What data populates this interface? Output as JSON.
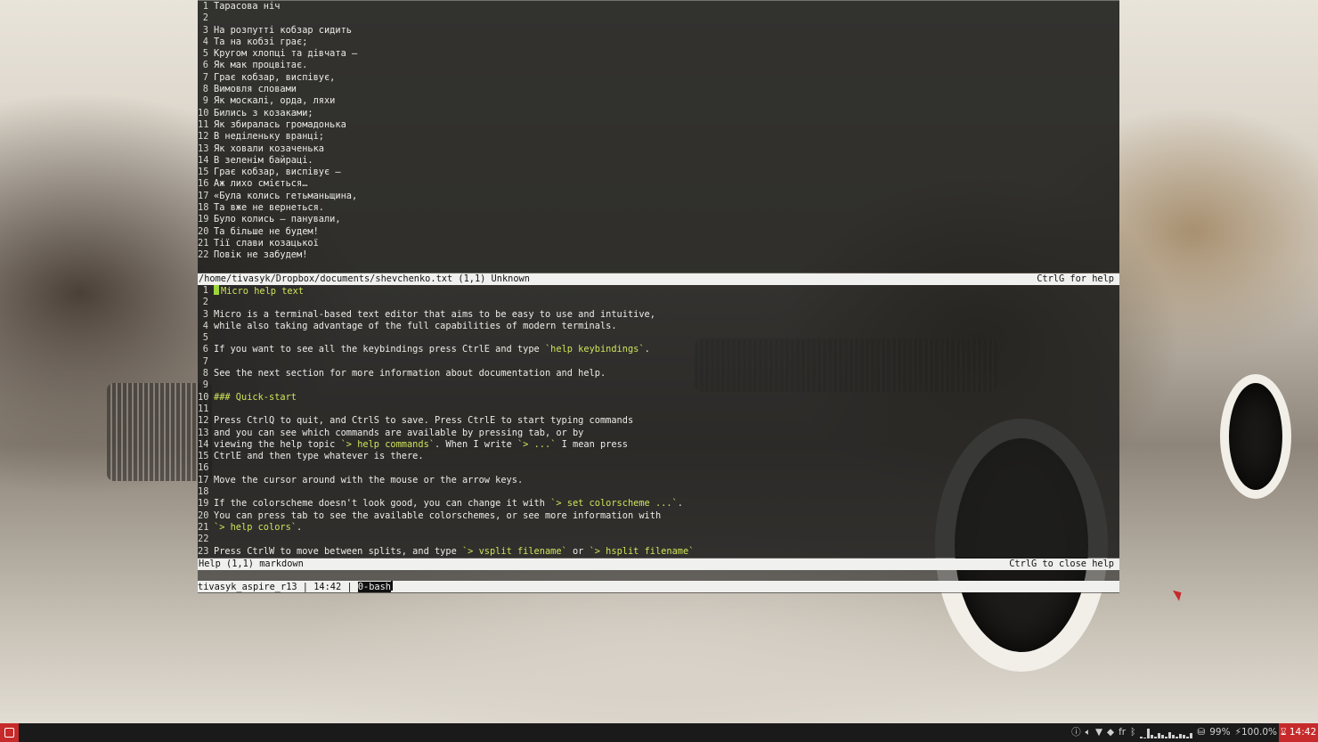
{
  "pane1": {
    "lines": [
      {
        "n": "1",
        "t": "Тарасова ніч"
      },
      {
        "n": "2",
        "t": ""
      },
      {
        "n": "3",
        "t": "На розпутті кобзар сидить"
      },
      {
        "n": "4",
        "t": "Та на кобзі грає;"
      },
      {
        "n": "5",
        "t": "Кругом хлопці та дівчата —"
      },
      {
        "n": "6",
        "t": "Як мак процвітає."
      },
      {
        "n": "7",
        "t": "Грає кобзар, виспівує,"
      },
      {
        "n": "8",
        "t": "Вимовля словами"
      },
      {
        "n": "9",
        "t": "Як москалі, орда, ляхи"
      },
      {
        "n": "10",
        "t": "Бились з козаками;"
      },
      {
        "n": "11",
        "t": "Як збиралась громадонька"
      },
      {
        "n": "12",
        "t": "В неділеньку вранці;"
      },
      {
        "n": "13",
        "t": "Як ховали козаченька"
      },
      {
        "n": "14",
        "t": "В зеленім байраці."
      },
      {
        "n": "15",
        "t": "Грає кобзар, виспівує —"
      },
      {
        "n": "16",
        "t": "Аж лихо сміється…"
      },
      {
        "n": "17",
        "t": "«Була колись гетьманьщина,"
      },
      {
        "n": "18",
        "t": "Та вже не вернеться."
      },
      {
        "n": "19",
        "t": "Було колись — панували,"
      },
      {
        "n": "20",
        "t": "Та більше не будем!"
      },
      {
        "n": "21",
        "t": "Тії слави козацької"
      },
      {
        "n": "22",
        "t": "Повік не забудем!"
      }
    ],
    "status_left": "/home/tivasyk/Dropbox/documents/shevchenko.txt (1,1) Unknown",
    "status_right": "CtrlG for help"
  },
  "pane2": {
    "line1_prefix": "# ",
    "line1_text": "Micro help text",
    "lines": [
      {
        "n": "2",
        "parts": [
          {
            "t": ""
          }
        ]
      },
      {
        "n": "3",
        "parts": [
          {
            "t": "Micro is a terminal-based text editor that aims to be easy to use and intuitive,"
          }
        ]
      },
      {
        "n": "4",
        "parts": [
          {
            "t": "while also taking advantage of the full capabilities of modern terminals."
          }
        ]
      },
      {
        "n": "5",
        "parts": [
          {
            "t": ""
          }
        ]
      },
      {
        "n": "6",
        "parts": [
          {
            "t": "If you want to see all the keybindings press CtrlE and type "
          },
          {
            "t": "`help keybindings`",
            "h": true
          },
          {
            "t": "."
          }
        ]
      },
      {
        "n": "7",
        "parts": [
          {
            "t": ""
          }
        ]
      },
      {
        "n": "8",
        "parts": [
          {
            "t": "See the next section for more information about documentation and help."
          }
        ]
      },
      {
        "n": "9",
        "parts": [
          {
            "t": ""
          }
        ]
      },
      {
        "n": "10",
        "parts": [
          {
            "t": "### Quick-start",
            "h": true
          }
        ]
      },
      {
        "n": "11",
        "parts": [
          {
            "t": ""
          }
        ]
      },
      {
        "n": "12",
        "parts": [
          {
            "t": "Press CtrlQ to quit, and CtrlS to save. Press CtrlE to start typing commands"
          }
        ]
      },
      {
        "n": "13",
        "parts": [
          {
            "t": "and you can see which commands are available by pressing tab, or by"
          }
        ]
      },
      {
        "n": "14",
        "parts": [
          {
            "t": "viewing the help topic "
          },
          {
            "t": "`> help commands`",
            "h": true
          },
          {
            "t": ". When I write "
          },
          {
            "t": "`> ...`",
            "h": true
          },
          {
            "t": " I mean press"
          }
        ]
      },
      {
        "n": "15",
        "parts": [
          {
            "t": "CtrlE and then type whatever is there."
          }
        ]
      },
      {
        "n": "16",
        "parts": [
          {
            "t": ""
          }
        ]
      },
      {
        "n": "17",
        "parts": [
          {
            "t": "Move the cursor around with the mouse or the arrow keys."
          }
        ]
      },
      {
        "n": "18",
        "parts": [
          {
            "t": ""
          }
        ]
      },
      {
        "n": "19",
        "parts": [
          {
            "t": "If the colorscheme doesn't look good, you can change it with "
          },
          {
            "t": "`> set colorscheme ...`",
            "h": true
          },
          {
            "t": "."
          }
        ]
      },
      {
        "n": "20",
        "parts": [
          {
            "t": "You can press tab to see the available colorschemes, or see more information with"
          }
        ]
      },
      {
        "n": "21",
        "parts": [
          {
            "t": "`> help colors`",
            "h": true
          },
          {
            "t": "."
          }
        ]
      },
      {
        "n": "22",
        "parts": [
          {
            "t": ""
          }
        ]
      },
      {
        "n": "23",
        "parts": [
          {
            "t": "Press CtrlW to move between splits, and type "
          },
          {
            "t": "`> vsplit filename`",
            "h": true
          },
          {
            "t": " or "
          },
          {
            "t": "`> hsplit filename`",
            "h": true
          }
        ]
      }
    ],
    "status_left": "Help (1,1) markdown",
    "status_right": "CtrlG to close help"
  },
  "tmux": {
    "host": "tivasyk_aspire_r13",
    "sep1": " | ",
    "time": "14:42",
    "sep2": " | ",
    "window": "0-bash"
  },
  "taskbar": {
    "tray_icons": [
      "help-icon",
      "volume-icon",
      "wifi-icon",
      "dropbox-icon"
    ],
    "keyboard_layout": "fr",
    "battery": "99%",
    "cpu_freq": "100.0%",
    "clock": "14:42",
    "cpu_bars": [
      0.2,
      0.1,
      0.9,
      0.3,
      0.2,
      0.5,
      0.3,
      0.2,
      0.6,
      0.3,
      0.2,
      0.4,
      0.3,
      0.2,
      0.5
    ]
  },
  "colors": {
    "accent": "#c62a2a",
    "highlight": "#cfe25a",
    "cursor": "#9dd63c"
  }
}
